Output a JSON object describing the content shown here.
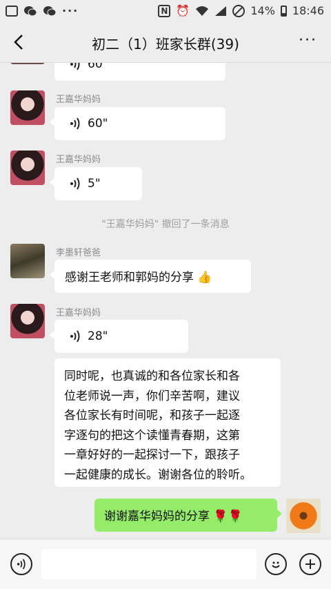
{
  "status_bar": {
    "battery": "14%",
    "time": "18:46",
    "dots": "···"
  },
  "header": {
    "title": "初二（1）班家长群(39)",
    "more": "···"
  },
  "messages": {
    "m0": {
      "duration": "60\""
    },
    "m1": {
      "sender": "王嘉华妈妈",
      "duration": "60\""
    },
    "m2": {
      "sender": "王嘉华妈妈",
      "duration": "5\""
    },
    "system": "\"王嘉华妈妈\" 撤回了一条消息",
    "m3": {
      "sender": "李墨轩爸爸",
      "text": "感谢王老师和郭妈的分享",
      "emoji": "👍"
    },
    "m4": {
      "sender": "王嘉华妈妈",
      "duration": "28\""
    },
    "m5": {
      "lines": [
        "同时呢，也真诚的和各位家长和各",
        "位老师说一声，你们辛苦啊，建议",
        "各位家长有时间呢，和孩子一起逐",
        "字逐句的把这个读懂青春期，这第",
        "一章好好的一起探讨一下，跟孩子",
        "一起健康的成长。谢谢各位的聆听。"
      ]
    },
    "m6": {
      "text": "谢谢嘉华妈妈的分享",
      "emoji": "🌹🌹"
    }
  },
  "colors": {
    "bg": "#ededed",
    "bubble_self": "#95ec69",
    "bubble_other": "#ffffff"
  }
}
